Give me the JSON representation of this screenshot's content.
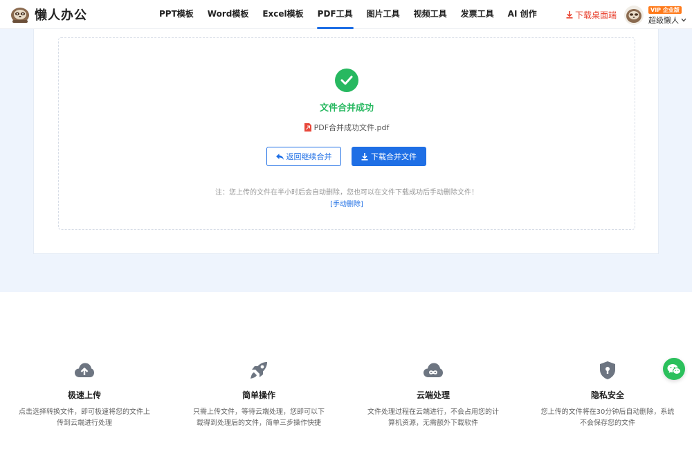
{
  "header": {
    "logo_text": "懒人办公",
    "nav": [
      {
        "label": "PPT模板",
        "active": false
      },
      {
        "label": "Word模板",
        "active": false
      },
      {
        "label": "Excel模板",
        "active": false
      },
      {
        "label": "PDF工具",
        "active": true
      },
      {
        "label": "图片工具",
        "active": false
      },
      {
        "label": "视频工具",
        "active": false
      },
      {
        "label": "发票工具",
        "active": false
      },
      {
        "label": "AI 创作",
        "active": false
      }
    ],
    "download_desktop": "下载桌面端",
    "vip_badge": "VIP 企业版",
    "username": "超级懒人"
  },
  "result": {
    "status_text": "文件合并成功",
    "file_name": "PDF合并成功文件.pdf",
    "back_button": "返回继续合并",
    "download_button": "下载合并文件",
    "note": "注：您上传的文件在半小时后会自动删除，您也可以在文件下载成功后手动删除文件！",
    "manual_delete": "[手动删除]"
  },
  "features": [
    {
      "icon": "cloud-upload-icon",
      "title": "极速上传",
      "desc": "点击选择转换文件，即可极速将您的文件上传到云端进行处理"
    },
    {
      "icon": "rocket-icon",
      "title": "简单操作",
      "desc": "只需上传文件，等待云端处理，您即可以下载得到处理后的文件，简单三步操作快捷"
    },
    {
      "icon": "cloud-process-icon",
      "title": "云端处理",
      "desc": "文件处理过程在云端进行，不会占用您的计算机资源，无需额外下载软件"
    },
    {
      "icon": "shield-lock-icon",
      "title": "隐私安全",
      "desc": "您上传的文件将在30分钟后自动删除，系统不会保存您的文件"
    }
  ],
  "colors": {
    "accent": "#1f6fe5",
    "success": "#27b860",
    "download_red": "#e8412e",
    "page_bg": "#eef4fd",
    "vip_orange": "#ff7a1a",
    "wechat_green": "#2bc05c",
    "feature_icon_gray": "#6d7581"
  }
}
